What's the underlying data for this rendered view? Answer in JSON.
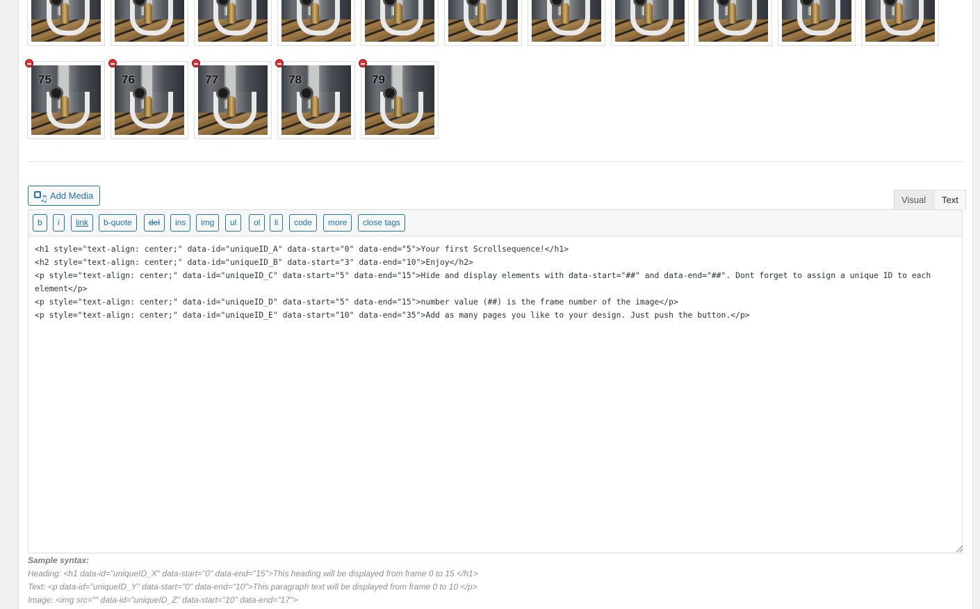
{
  "gallery": {
    "rows": [
      [
        "",
        "",
        "",
        "",
        "",
        "",
        "",
        "",
        "",
        "",
        ""
      ],
      [
        "75",
        "76",
        "77",
        "78",
        "79"
      ]
    ]
  },
  "media": {
    "add_label": "Add Media"
  },
  "tabs": {
    "visual": "Visual",
    "text": "Text"
  },
  "quicktags": [
    "b",
    "i",
    "link",
    "b-quote",
    "del",
    "ins",
    "img",
    "ul",
    "ol",
    "li",
    "code",
    "more",
    "close tags"
  ],
  "editor": {
    "content": "<h1 style=\"text-align: center;\" data-id=\"uniqueID_A\" data-start=\"0\" data-end=\"5\">Your first Scrollsequence!</h1>\n<h2 style=\"text-align: center;\" data-id=\"uniqueID_B\" data-start=\"3\" data-end=\"10\">Enjoy</h2>\n<p style=\"text-align: center;\" data-id=\"uniqueID_C\" data-start=\"5\" data-end=\"15\">Hide and display elements with data-start=\"##\" and data-end=\"##\". Dont forget to assign a unique ID to each element</p>\n<p style=\"text-align: center;\" data-id=\"uniqueID_D\" data-start=\"5\" data-end=\"15\">number value (##) is the frame number of the image</p>\n<p style=\"text-align: center;\" data-id=\"uniqueID_E\" data-start=\"10\" data-end=\"35\">Add as many pages you like to your design. Just push the button.</p>"
  },
  "help": {
    "heading": "Sample syntax:",
    "heading_line": "Heading: <h1 data-id=\"uniqueID_X\" data-start=\"0\" data-end=\"15\">This heading will be displayed from frame 0 to 15 </h1>",
    "text_line": "Text: <p data-id=\"uniqueID_Y\" data-start=\"0\" data-end=\"10\">This paragraph text will be displayed from frame 0 to 10 </p>",
    "image_line": "Image: <img src=\"\" data-id=\"uniqueID_Z\" data-start=\"10\" data-end=\"17\">"
  },
  "colors": {
    "accent": "#2271b1",
    "remove": "#d63638"
  }
}
